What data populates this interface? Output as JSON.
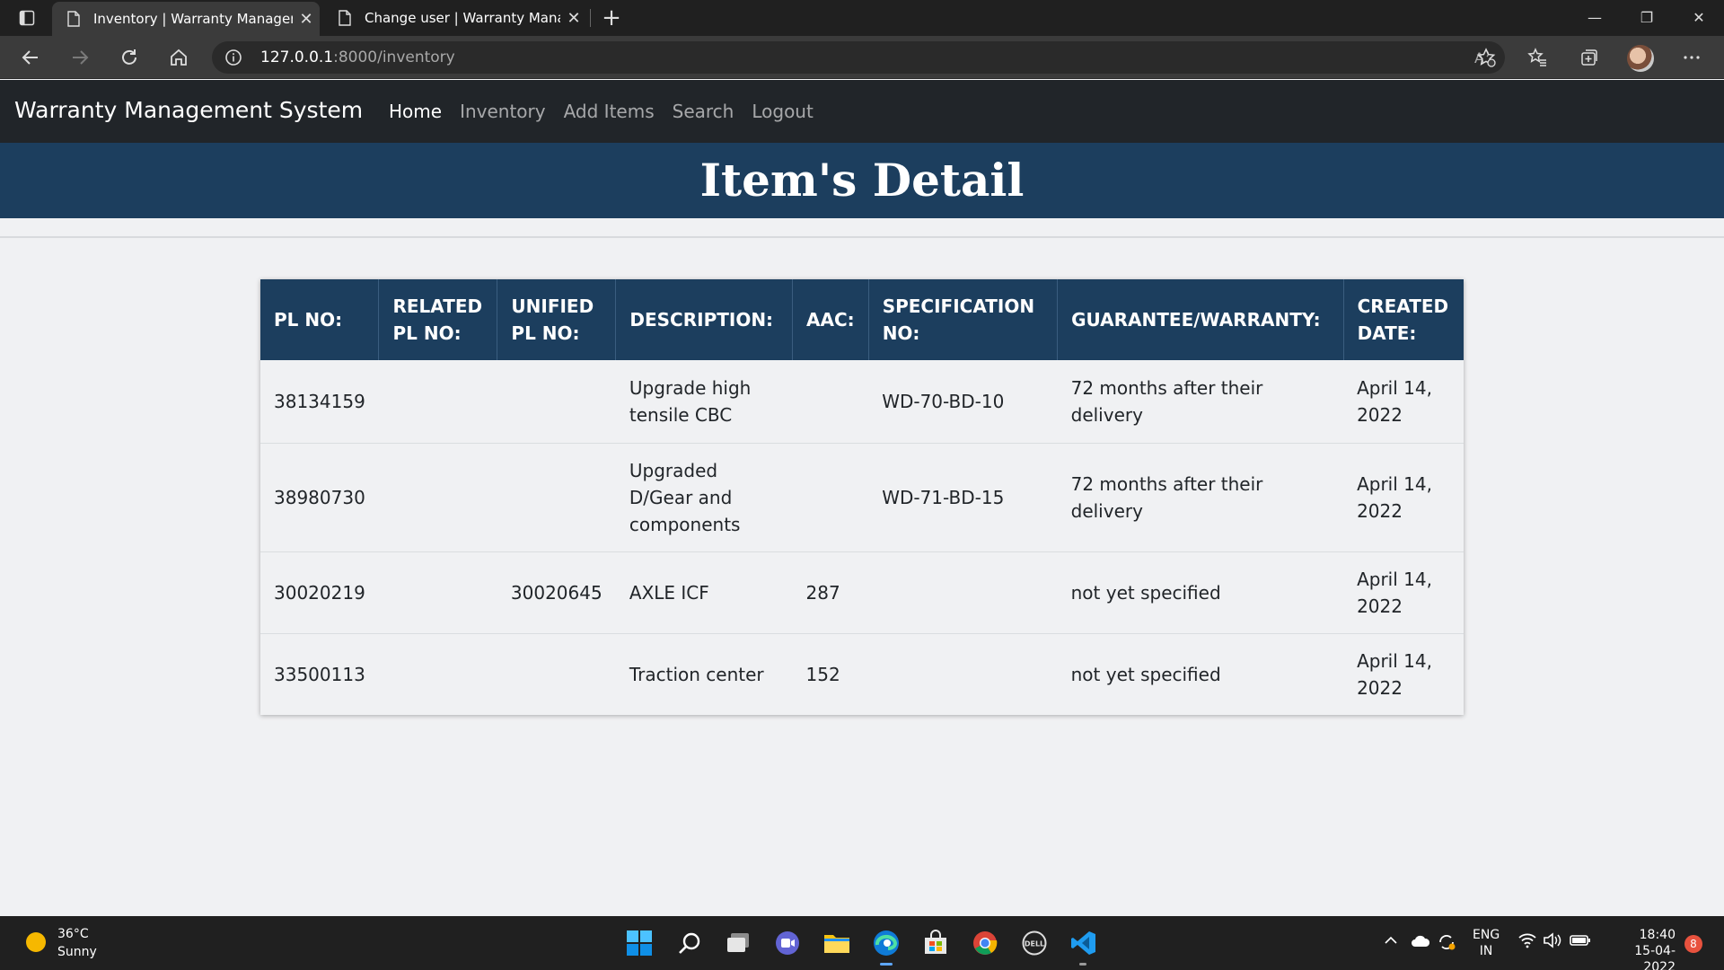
{
  "browser": {
    "tabs": [
      {
        "title": "Inventory | Warranty Management System",
        "active": true
      },
      {
        "title": "Change user | Warranty Management System",
        "active": false
      }
    ],
    "url_host": "127.0.0.1",
    "url_path": ":8000/inventory"
  },
  "site": {
    "brand": "Warranty Management System",
    "nav": {
      "home": "Home",
      "inventory": "Inventory",
      "add_items": "Add Items",
      "search": "Search",
      "logout": "Logout"
    },
    "page_title": "Item's Detail"
  },
  "table": {
    "headers": [
      "PL NO:",
      "RELATED PL NO:",
      "UNIFIED PL NO:",
      "DESCRIPTION:",
      "AAC:",
      "SPECIFICATION NO:",
      "GUARANTEE/WARRANTY:",
      "CREATED DATE:"
    ],
    "rows": [
      [
        "38134159",
        "",
        "",
        "Upgrade high tensile CBC",
        "",
        "WD-70-BD-10",
        "72 months after their delivery",
        "April 14, 2022"
      ],
      [
        "38980730",
        "",
        "",
        "Upgraded D/Gear and components",
        "",
        "WD-71-BD-15",
        "72 months after their delivery",
        "April 14, 2022"
      ],
      [
        "30020219",
        "",
        "30020645",
        "AXLE ICF",
        "287",
        "",
        "not yet specified",
        "April 14, 2022"
      ],
      [
        "33500113",
        "",
        "",
        "Traction center",
        "152",
        "",
        "not yet specified",
        "April 14, 2022"
      ]
    ]
  },
  "taskbar": {
    "weather_temp": "36°C",
    "weather_desc": "Sunny",
    "lang_1": "ENG",
    "lang_2": "IN",
    "time": "18:40",
    "date": "15-04-2022",
    "notifications": "8"
  },
  "colors": {
    "header_blue": "#1c3e5e",
    "navbar_dark": "#212529",
    "page_bg": "#f0f1f3"
  }
}
